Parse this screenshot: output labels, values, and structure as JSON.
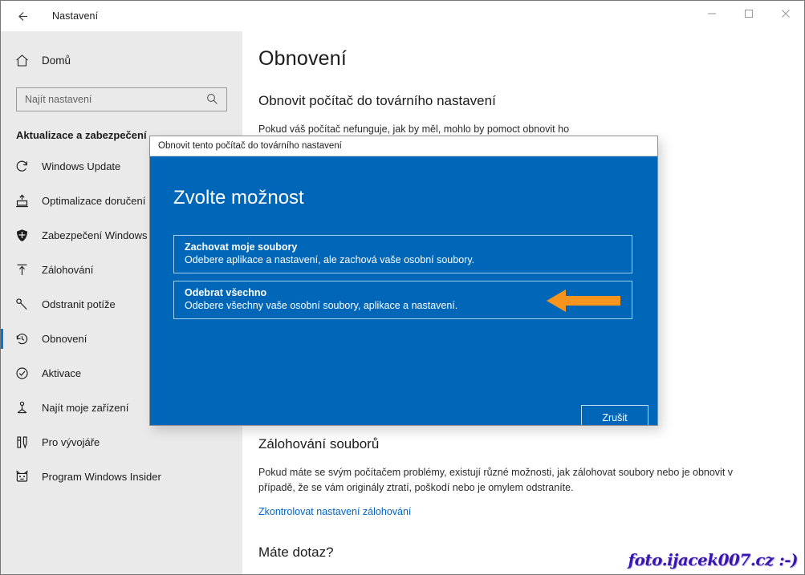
{
  "window": {
    "title": "Nastavení",
    "back_icon": "arrow-left-icon",
    "minimize_label": "—",
    "maximize_label": "□",
    "close_label": "✕"
  },
  "sidebar": {
    "home": {
      "label": "Domů",
      "icon": "home-icon"
    },
    "search": {
      "placeholder": "Najít nastavení",
      "value": "",
      "icon": "search-icon"
    },
    "section_title": "Aktualizace a zabezpečení",
    "items": [
      {
        "label": "Windows Update",
        "icon": "refresh-icon",
        "active": false
      },
      {
        "label": "Optimalizace doručení",
        "icon": "delivery-optimization-icon",
        "active": false
      },
      {
        "label": "Zabezpečení Windows",
        "icon": "shield-icon",
        "active": false
      },
      {
        "label": "Zálohování",
        "icon": "upload-arrow-icon",
        "active": false
      },
      {
        "label": "Odstranit potíže",
        "icon": "wrench-icon",
        "active": false
      },
      {
        "label": "Obnovení",
        "icon": "history-clock-icon",
        "active": true
      },
      {
        "label": "Aktivace",
        "icon": "check-circle-icon",
        "active": false
      },
      {
        "label": "Najít moje zařízení",
        "icon": "find-device-icon",
        "active": false
      },
      {
        "label": "Pro vývojáře",
        "icon": "developer-tools-icon",
        "active": false
      },
      {
        "label": "Program Windows Insider",
        "icon": "insider-cat-icon",
        "active": false
      }
    ]
  },
  "main": {
    "page_title": "Obnovení",
    "reset_section": {
      "heading": "Obnovit počítač do továrního nastavení",
      "paragraph": "Pokud váš počítač nefunguje, jak by měl, mohlo by pomoct obnovit ho"
    },
    "backup_section": {
      "heading": "Zálohování souborů",
      "paragraph": "Pokud máte se svým počítačem problémy, existují různé možnosti, jak zálohovat soubory nebo je obnovit v případě, že se vám originály ztratí, poškodí nebo je omylem odstraníte.",
      "link": "Zkontrolovat nastavení zálohování"
    },
    "question_section": {
      "heading": "Máte dotaz?"
    }
  },
  "dialog": {
    "titlebar": "Obnovit tento počítač do továrního nastavení",
    "heading": "Zvolte možnost",
    "options": [
      {
        "title": "Zachovat moje soubory",
        "description": "Odebere aplikace a nastavení, ale zachová vaše osobní soubory."
      },
      {
        "title": "Odebrat všechno",
        "description": "Odebere všechny vaše osobní soubory, aplikace a nastavení."
      }
    ],
    "annotation_icon": "arrow-left-annotation-icon",
    "cancel_label": "Zrušit"
  },
  "watermark": {
    "text": "foto.ijacek007.cz :-)"
  },
  "colors": {
    "dialog_blue": "#0067b8",
    "accent_blue": "#0078d7",
    "link_blue": "#0066cc",
    "annotation_orange": "#f7941e",
    "sidebar_gray": "#eaeaea",
    "watermark_purple": "#3a16b0"
  }
}
